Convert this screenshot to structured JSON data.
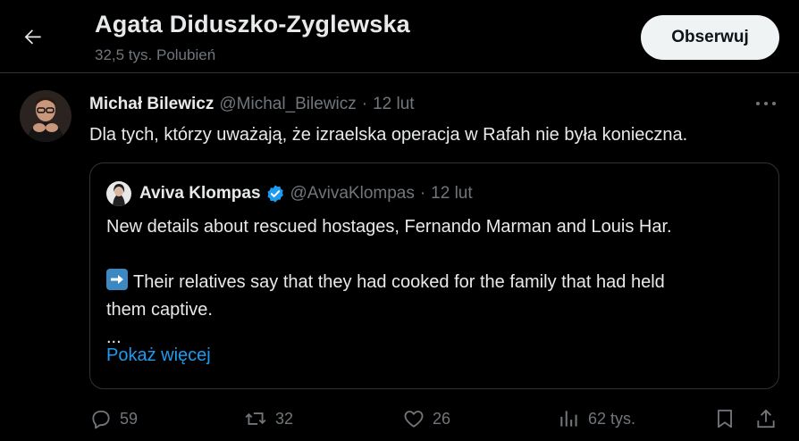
{
  "header": {
    "title": "Agata Diduszko-Zyglewska",
    "subtitle": "32,5 tys. Polubień",
    "follow_label": "Obserwuj"
  },
  "tweet": {
    "author_name": "Michał Bilewicz",
    "author_handle": "@Michal_Bilewicz",
    "separator": "·",
    "time": "12 lut",
    "text": "Dla tych, którzy uważają, że izraelska operacja w Rafah nie była konieczna."
  },
  "quote": {
    "author_name": "Aviva Klompas",
    "author_handle": "@AvivaKlompas",
    "separator": "·",
    "time": "12 lut",
    "verified": true,
    "line1": "New details about rescued hostages, Fernando Marman and Louis Har.",
    "line2": "Their relatives say that they had cooked for the family that had held",
    "line3": "them captive.",
    "line4": "...",
    "show_more": "Pokaż więcej"
  },
  "actions": {
    "replies": "59",
    "reposts": "32",
    "likes": "26",
    "views": "62 tys."
  },
  "icons": {
    "back": "arrow-left-icon",
    "more": "more-horizontal-icon",
    "verified": "verified-badge-icon",
    "arrow_emoji": "right-arrow-emoji-icon",
    "reply": "reply-icon",
    "repost": "repost-icon",
    "like": "heart-icon",
    "views": "views-chart-icon",
    "bookmark": "bookmark-icon",
    "share": "share-icon"
  },
  "colors": {
    "background": "#000000",
    "text": "#e7e9ea",
    "muted": "#71767b",
    "accent": "#1d9bf0",
    "border": "#2f3336",
    "follow_bg": "#eff3f4"
  }
}
